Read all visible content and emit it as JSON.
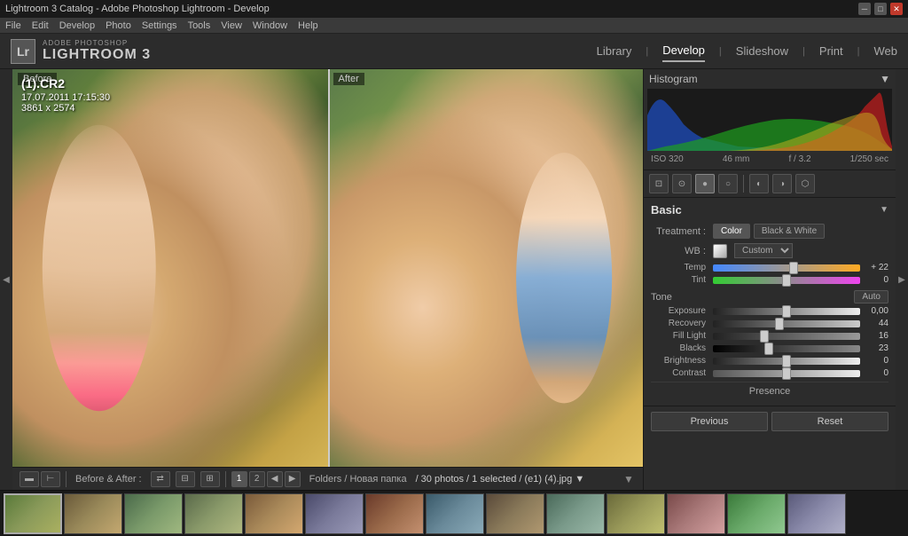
{
  "window": {
    "title": "Lightroom 3 Catalog - Adobe Photoshop Lightroom - Develop"
  },
  "menubar": {
    "items": [
      "File",
      "Edit",
      "Develop",
      "Photo",
      "Settings",
      "Tools",
      "View",
      "Window",
      "Help"
    ]
  },
  "logo": {
    "adobe_text": "ADOBE PHOTOSHOP",
    "app_name": "LIGHTROOM 3",
    "icon_text": "Lr"
  },
  "nav": {
    "tabs": [
      "Library",
      "Develop",
      "Slideshow",
      "Print",
      "Web"
    ],
    "active": "Develop",
    "separator": "|"
  },
  "image_info": {
    "filename": "(1).CR2",
    "datetime": "17.07.2011 17:15:30",
    "dimensions": "3861 x 2574"
  },
  "labels": {
    "before": "Before",
    "after": "After"
  },
  "histogram": {
    "title": "Histogram",
    "iso": "ISO 320",
    "focal": "46 mm",
    "aperture": "f / 3.2",
    "shutter": "1/250 sec"
  },
  "basic": {
    "title": "Basic",
    "treatment_label": "Treatment :",
    "color_btn": "Color",
    "bw_btn": "Black & White",
    "wb_label": "WB :",
    "wb_value": "Custom ÷",
    "tone_label": "Tone",
    "auto_btn": "Auto",
    "sliders": [
      {
        "name": "Temp",
        "value": "+ 22",
        "position": 55
      },
      {
        "name": "Tint",
        "value": "0",
        "position": 50
      },
      {
        "name": "Exposure",
        "value": "0.00",
        "position": 50
      },
      {
        "name": "Recovery",
        "value": "44",
        "position": 45
      },
      {
        "name": "Fill Light",
        "value": "16",
        "position": 35
      },
      {
        "name": "Blacks",
        "value": "23",
        "position": 38
      },
      {
        "name": "Brightness",
        "value": "0",
        "position": 50
      },
      {
        "name": "Contrast",
        "value": "0",
        "position": 50
      }
    ],
    "presence_label": "Presence"
  },
  "panel_buttons": {
    "previous": "Previous",
    "reset": "Reset"
  },
  "bottom_toolbar": {
    "before_after_label": "Before & After :",
    "folder_path": "Folders / Новая папка",
    "photo_count": "/ 30 photos / 1 selected / (e1) (4).jpg ▼"
  },
  "filmstrip": {
    "thumbs": 14,
    "active_index": 1
  },
  "page_nums": [
    "1",
    "2"
  ],
  "tools": [
    "grid",
    "crop",
    "spot",
    "redeye",
    "brush",
    "filter"
  ]
}
